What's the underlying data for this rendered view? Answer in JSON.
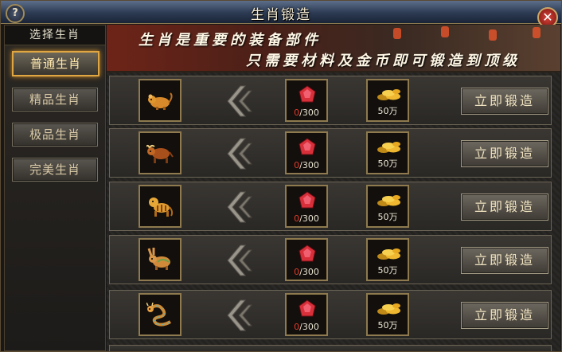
{
  "window": {
    "title": "生肖锻造",
    "help_label": "?",
    "close_label": "✕"
  },
  "sidebar": {
    "header": "选择生肖",
    "tabs": [
      {
        "label": "普通生肖",
        "active": true
      },
      {
        "label": "精品生肖",
        "active": false
      },
      {
        "label": "极品生肖",
        "active": false
      },
      {
        "label": "完美生肖",
        "active": false
      }
    ]
  },
  "banner": {
    "line1": "生肖是重要的装备部件",
    "line2": "只需要材料及金币即可锻造到顶级"
  },
  "recipes": [
    {
      "zodiac": "rat-icon",
      "have": "0",
      "need": "/300",
      "price": "50万",
      "button": "立即锻造"
    },
    {
      "zodiac": "ox-icon",
      "have": "0",
      "need": "/300",
      "price": "50万",
      "button": "立即锻造"
    },
    {
      "zodiac": "tiger-icon",
      "have": "0",
      "need": "/300",
      "price": "50万",
      "button": "立即锻造"
    },
    {
      "zodiac": "rabbit-icon",
      "have": "0",
      "need": "/300",
      "price": "50万",
      "button": "立即锻造"
    },
    {
      "zodiac": "dragon-icon",
      "have": "0",
      "need": "/300",
      "price": "50万",
      "button": "立即锻造"
    }
  ],
  "colors": {
    "accent": "#e0a642",
    "shortfall": "#e23a2a",
    "gem": "#d8303a",
    "gold": "#f0b830"
  }
}
